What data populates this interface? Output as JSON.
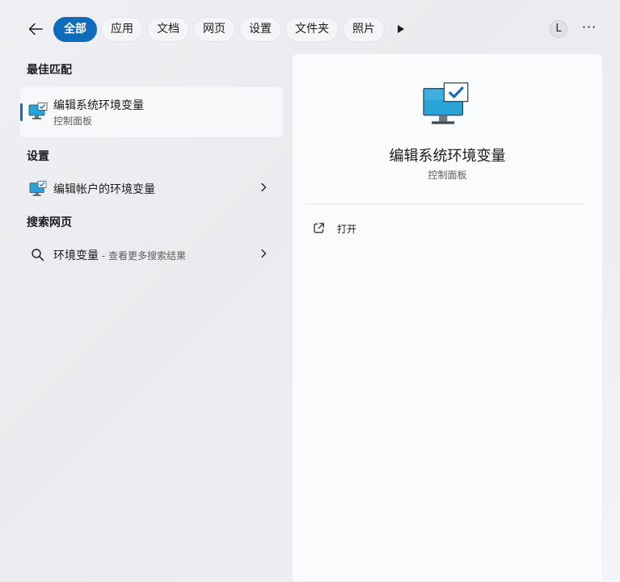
{
  "topbar": {
    "tabs": [
      "全部",
      "应用",
      "文档",
      "网页",
      "设置",
      "文件夹",
      "照片"
    ],
    "avatar_initial": "L",
    "more_label": "···"
  },
  "left": {
    "best_match_heading": "最佳匹配",
    "best_match": {
      "title": "编辑系统环境变量",
      "subtitle": "控制面板"
    },
    "settings_heading": "设置",
    "settings_item": {
      "label": "编辑帐户的环境变量"
    },
    "web_heading": "搜索网页",
    "web_item": {
      "label": "环境变量",
      "hint": " - 查看更多搜索结果"
    }
  },
  "detail": {
    "title": "编辑系统环境变量",
    "subtitle": "控制面板",
    "actions": [
      {
        "label": "打开",
        "icon": "open-external-icon"
      }
    ]
  }
}
